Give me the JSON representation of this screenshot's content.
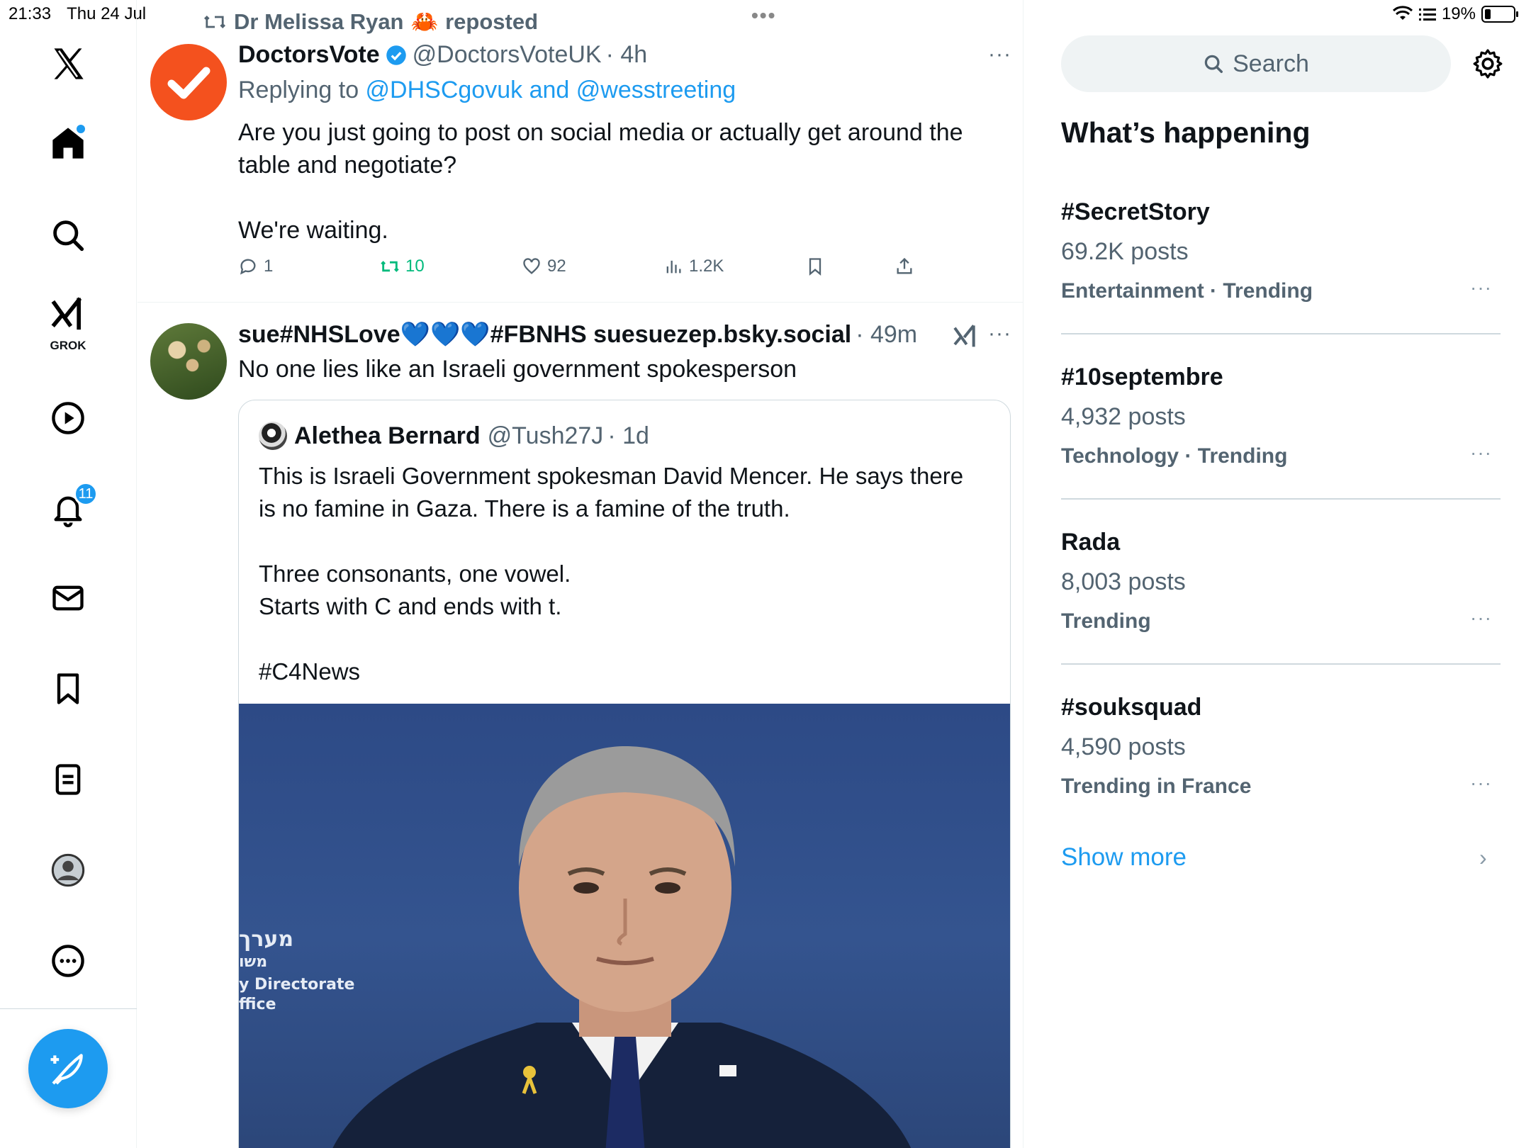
{
  "status_bar": {
    "time": "21:33",
    "date": "Thu 24 Jul",
    "battery": "19%",
    "center_dots": "•••"
  },
  "sidebar": {
    "notifications_count": "11",
    "grok_label": "GROK"
  },
  "repost": {
    "by": "Dr Melissa Ryan",
    "emoji": "🦀",
    "suffix": "reposted"
  },
  "tweet1": {
    "name": "DoctorsVote",
    "handle": "@DoctorsVoteUK",
    "time": "· 4h",
    "more": "···",
    "replying_prefix": "Replying to ",
    "replying_to": "@DHSCgovuk and @wesstreeting",
    "text": "Are you just going to post on social media or actually get around the\ntable and negotiate?\n\nWe're waiting.",
    "replies": "1",
    "reposts": "10",
    "likes": "92",
    "views": "1.2K"
  },
  "tweet2": {
    "name": "sue#NHSLove💙💙💙#FBNHS suesuezep.bsky.social",
    "time": "· 49m",
    "more": "···",
    "text": "No one lies like an Israeli government spokesperson",
    "quote": {
      "name": "Alethea Bernard",
      "handle": "@Tush27J",
      "time": "· 1d",
      "text": "This is Israeli Government spokesman David Mencer. He says there\nis no famine in Gaza. There is a famine of the truth.\n\nThree consonants, one vowel.\nStarts with C and ends with t.\n\n#C4News",
      "image_caption_lines": [
        "מערך",
        "משו",
        "y Directorate",
        "ffice"
      ]
    }
  },
  "right": {
    "search_placeholder": "Search",
    "whats_happening": "What’s happening",
    "trends": [
      {
        "title": "#SecretStory",
        "count": "69.2K posts",
        "category": "Entertainment · Trending"
      },
      {
        "title": "#10septembre",
        "count": "4,932 posts",
        "category": "Technology · Trending"
      },
      {
        "title": "Rada",
        "count": "8,003 posts",
        "category": "Trending"
      },
      {
        "title": "#souksquad",
        "count": "4,590 posts",
        "category": "Trending in France"
      }
    ],
    "trend_more": "···",
    "show_more": "Show more",
    "show_more_chevron": "›"
  },
  "colors": {
    "accent": "#1d9bf0",
    "repost_green": "#00ba7c",
    "secondary_text": "#536471",
    "doctorsvote_orange": "#f4511e"
  }
}
